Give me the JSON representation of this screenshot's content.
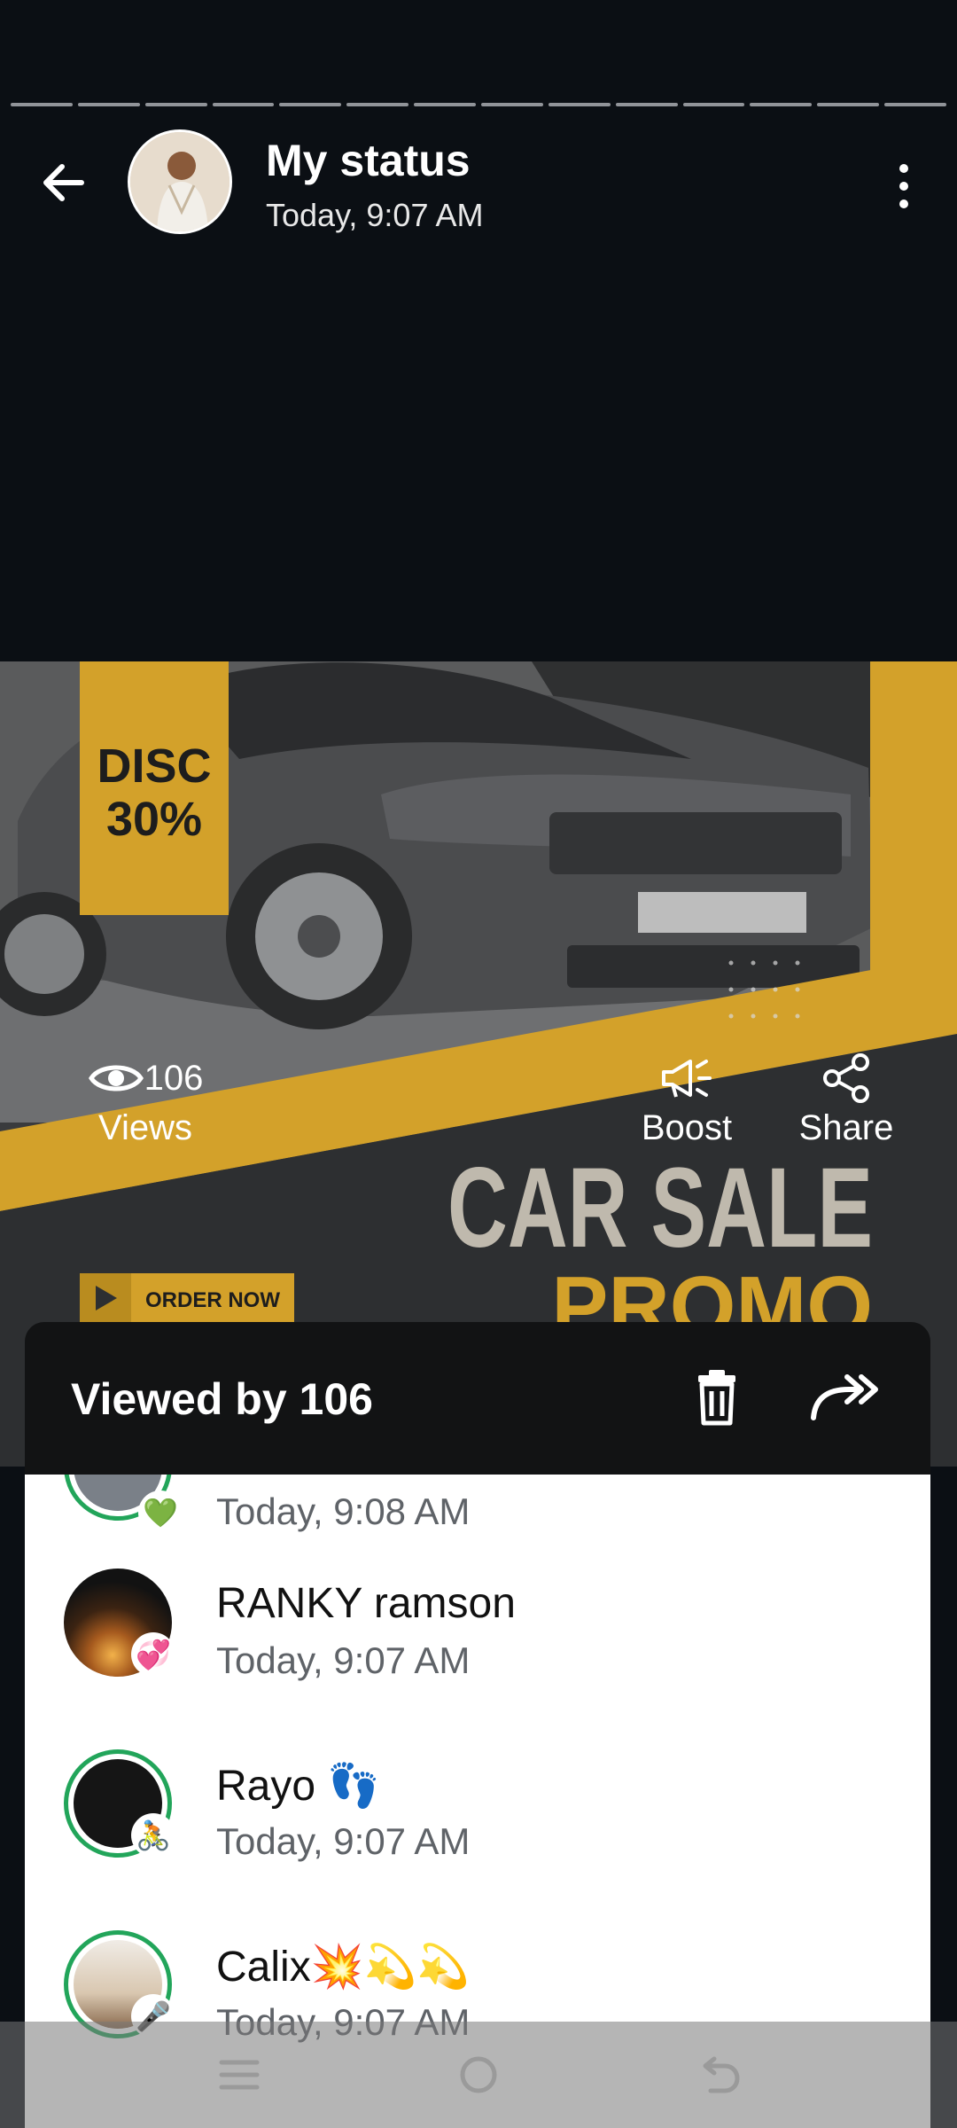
{
  "header": {
    "title": "My status",
    "subtitle": "Today, 9:07 AM",
    "progress_segments": 14
  },
  "status_image": {
    "badge_line1": "DISC",
    "badge_line2": "30%",
    "headline": "CAR SALE",
    "subheadline": "PROMO",
    "cta": "ORDER NOW",
    "accent_color": "#d3a12a"
  },
  "stats": {
    "views_count": "106",
    "views_label": "Views",
    "boost_label": "Boost",
    "share_label": "Share"
  },
  "sheet": {
    "title": "Viewed by 106"
  },
  "viewers": [
    {
      "name": "",
      "time": "Today, 9:08 AM",
      "badge": "💚",
      "ring": "#22a55a"
    },
    {
      "name": "RANKY ramson",
      "time": "Today, 9:07 AM",
      "badge": "💞",
      "ring": "none"
    },
    {
      "name": "Rayo 👣",
      "time": "Today, 9:07 AM",
      "badge": "🚴",
      "ring": "#22a55a"
    },
    {
      "name": "Calix💥💫💫",
      "time": "Today, 9:07 AM",
      "badge": "🎤",
      "ring": "#22a55a"
    }
  ]
}
